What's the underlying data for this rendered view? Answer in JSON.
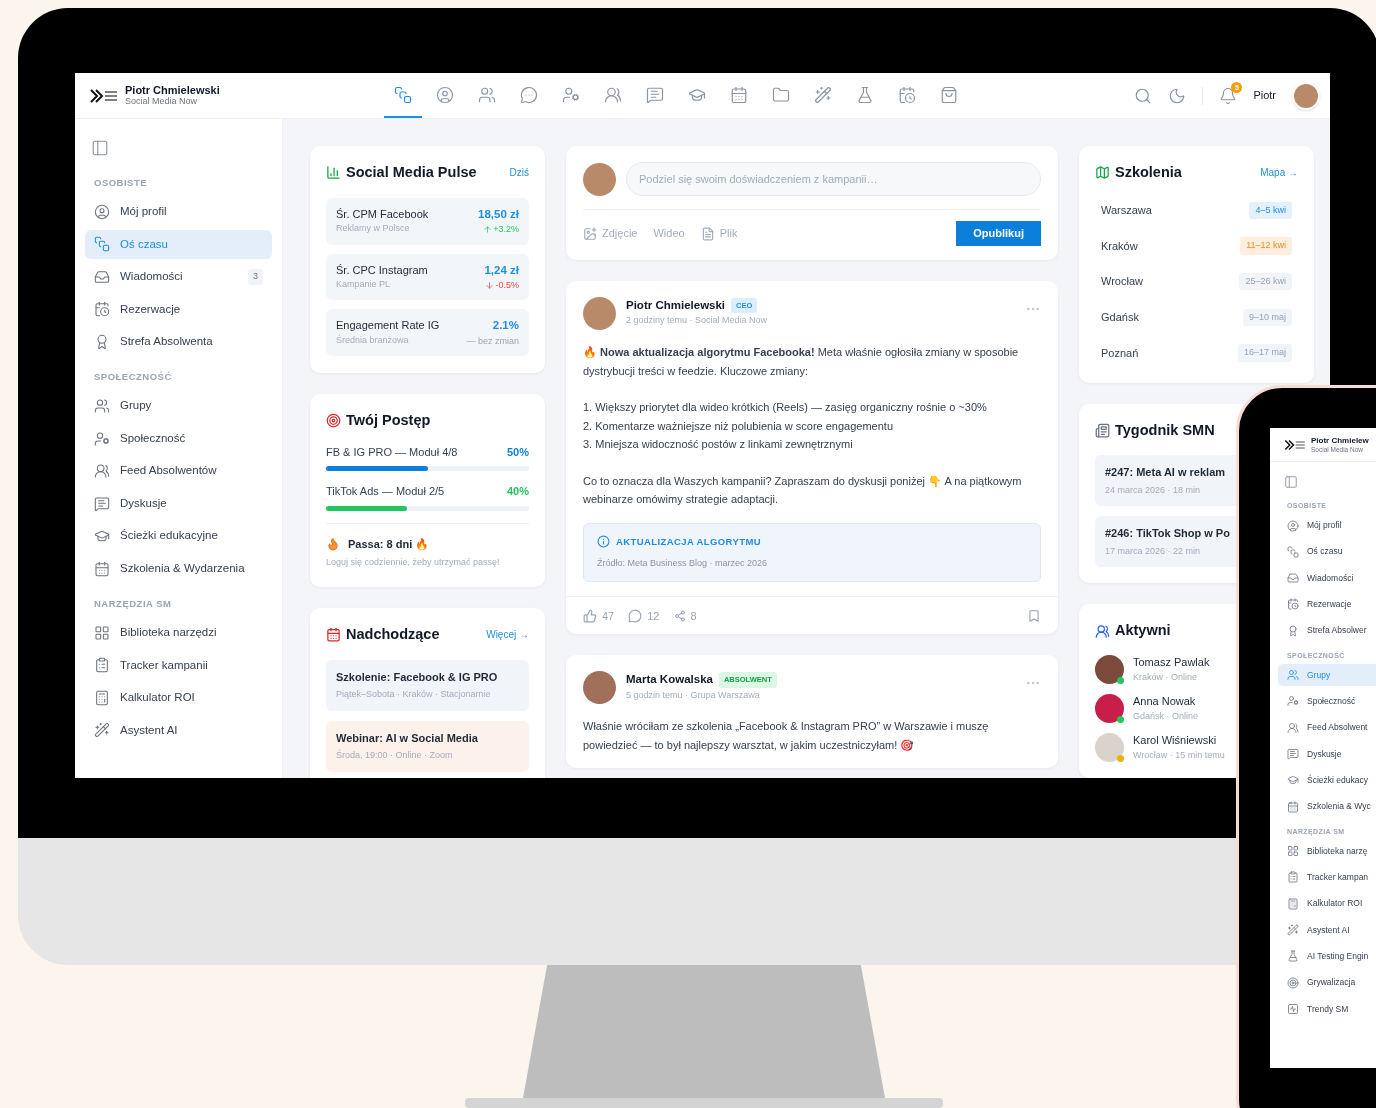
{
  "header": {
    "brand": {
      "name": "Piotr Chmielewski",
      "subtitle": "Social Media Now"
    },
    "nav": [
      {
        "selected": true
      },
      {
        "selected": false
      },
      {
        "selected": false
      },
      {
        "selected": false
      },
      {
        "selected": false
      },
      {
        "selected": false
      },
      {
        "selected": false
      },
      {
        "selected": false
      },
      {
        "selected": false
      },
      {
        "selected": false
      },
      {
        "selected": false
      },
      {
        "selected": false
      },
      {
        "selected": false
      },
      {
        "selected": false
      }
    ],
    "notifications": "5",
    "user": "Piotr"
  },
  "sidebar": {
    "sections": [
      {
        "title": "OSOBISTE",
        "items": [
          {
            "label": "Mój profil",
            "selected": false
          },
          {
            "label": "Oś czasu",
            "selected": true
          },
          {
            "label": "Wiadomości",
            "selected": false,
            "badge": "3"
          },
          {
            "label": "Rezerwacje",
            "selected": false
          },
          {
            "label": "Strefa Absolwenta",
            "selected": false
          }
        ]
      },
      {
        "title": "SPOŁECZNOŚĆ",
        "items": [
          {
            "label": "Grupy",
            "selected": false
          },
          {
            "label": "Społeczność",
            "selected": false
          },
          {
            "label": "Feed Absolwentów",
            "selected": false
          },
          {
            "label": "Dyskusje",
            "selected": false
          },
          {
            "label": "Ścieżki edukacyjne",
            "selected": false
          },
          {
            "label": "Szkolenia & Wydarzenia",
            "selected": false
          }
        ]
      },
      {
        "title": "NARZĘDZIA SM",
        "items": [
          {
            "label": "Biblioteka narzędzi",
            "selected": false
          },
          {
            "label": "Tracker kampanii",
            "selected": false
          },
          {
            "label": "Kalkulator ROI",
            "selected": false
          },
          {
            "label": "Asystent AI",
            "selected": false
          }
        ]
      }
    ]
  },
  "pulse": {
    "title": "Social Media Pulse",
    "link": "Dziś",
    "metrics": [
      {
        "label": "Śr. CPM Facebook",
        "sub": "Reklamy w Polsce",
        "value": "18,50 zł",
        "change": "+3.2%",
        "kind": "up"
      },
      {
        "label": "Śr. CPC Instagram",
        "sub": "Kampanie PL",
        "value": "1,24 zł",
        "change": "-0.5%",
        "kind": "down"
      },
      {
        "label": "Engagement Rate IG",
        "sub": "Średnia branżowa",
        "value": "2.1%",
        "change": "— bez zmian",
        "kind": "flat"
      }
    ]
  },
  "progress": {
    "title": "Twój Postęp",
    "courses": [
      {
        "label": "FB & IG PRO — Moduł 4/8",
        "percent": "50%",
        "level": 0.5,
        "color": "#0b7fd9"
      },
      {
        "label": "TikTok Ads — Moduł 2/5",
        "percent": "40%",
        "level": 0.4,
        "color": "#22c55e"
      }
    ],
    "streak": "Passa: 8 dni 🔥",
    "streak_hint": "Loguj się codziennie, żeby utrzymać passę!"
  },
  "upcoming": {
    "title": "Nadchodzące",
    "link": "Więcej →",
    "events": [
      {
        "title": "Szkolenie: Facebook & IG PRO",
        "details": "Piątek–Sobota · Kraków · Stacjonarnie",
        "kind": "training"
      },
      {
        "title": "Webinar: AI w Social Media",
        "details": "Środa, 19:00 · Online · Zoom",
        "kind": "webinar"
      }
    ]
  },
  "composer": {
    "placeholder": "Podziel się swoim doświadczeniem z kampanii…",
    "actions": [
      "Zdjęcie",
      "Wideo",
      "Plik"
    ],
    "submit": "Opublikuj"
  },
  "posts": [
    {
      "author": "Piotr Chmielewski",
      "badge": "CEO",
      "kind": "ceo",
      "meta": "2 godziny temu · Social Media Now",
      "body": [
        "🔥 **Nowa aktualizacja algorytmu Facebooka!** Meta właśnie ogłosiła zmiany w sposobie dystrybucji treści w feedzie. Kluczowe zmiany:",
        "1. Większy priorytet dla wideo krótkich (Reels) — zasięg organiczny rośnie o ~30%",
        "2. Komentarze ważniejsze niż polubienia w score engagementu",
        "3. Mniejsza widoczność postów z linkami zewnętrznymi",
        "Co to oznacza dla Waszych kampanii? Zapraszam do dyskusji poniżej 👇 A na piątkowym webinarze omówimy strategie adaptacji."
      ],
      "note": {
        "title": "AKTUALIZACJA ALGORYTMU",
        "source": "Źródło: Meta Business Blog · marzec 2026"
      },
      "likes": "47",
      "comments": "12",
      "shares": "8"
    },
    {
      "author": "Marta Kowalska",
      "badge": "ABSOLWENT",
      "kind": "alumni",
      "meta": "5 godzin temu · Grupa Warszawa",
      "body": [
        "Właśnie wróciłam ze szkolenia „Facebook & Instagram PRO” w Warszawie i muszę powiedzieć — to był najlepszy warsztat, w jakim uczestniczyłam! 🎯"
      ]
    }
  ],
  "trainings": {
    "title": "Szkolenia",
    "link": "Mapa →",
    "cities": [
      {
        "city": "Warszawa",
        "dates": "4–5 kwi",
        "kind": "next"
      },
      {
        "city": "Kraków",
        "dates": "11–12 kwi",
        "kind": "soon"
      },
      {
        "city": "Wrocław",
        "dates": "25–26 kwi",
        "kind": "later"
      },
      {
        "city": "Gdańsk",
        "dates": "9–10 maj",
        "kind": "later"
      },
      {
        "city": "Poznań",
        "dates": "16–17 maj",
        "kind": "later"
      }
    ]
  },
  "newsletter": {
    "title": "Tygodnik SMN",
    "issues": [
      {
        "title": "#247: Meta AI w reklam",
        "meta": "24 marca 2026 · 18 min"
      },
      {
        "title": "#246: TikTok Shop w Po",
        "meta": "17 marca 2026 · 22 min"
      }
    ]
  },
  "active": {
    "title": "Aktywni",
    "users": [
      {
        "name": "Tomasz Pawlak",
        "meta": "Kraków · Online",
        "color": "#22c55e"
      },
      {
        "name": "Anna Nowak",
        "meta": "Gdańsk · Online",
        "color": "#22c55e"
      },
      {
        "name": "Karol Wiśniewski",
        "meta": "Wrocław · 15 min temu",
        "color": "#eab308"
      }
    ]
  },
  "phone": {
    "brand": {
      "name": "Piotr Chmielew",
      "subtitle": "Social Media Now"
    },
    "sections": [
      {
        "title": "OSOBISTE",
        "items": [
          {
            "label": "Mój profil",
            "selected": false
          },
          {
            "label": "Oś czasu",
            "selected": false
          },
          {
            "label": "Wiadomości",
            "selected": false
          },
          {
            "label": "Rezerwacje",
            "selected": false
          },
          {
            "label": "Strefa Absolwer",
            "selected": false
          }
        ]
      },
      {
        "title": "SPOŁECZNOŚĆ",
        "items": [
          {
            "label": "Grupy",
            "selected": true
          },
          {
            "label": "Społeczność",
            "selected": false
          },
          {
            "label": "Feed Absolwent",
            "selected": false
          },
          {
            "label": "Dyskusje",
            "selected": false
          },
          {
            "label": "Ścieżki edukacy",
            "selected": false
          },
          {
            "label": "Szkolenia & Wyc",
            "selected": false
          }
        ]
      },
      {
        "title": "NARZĘDZIA SM",
        "items": [
          {
            "label": "Biblioteka narzę",
            "selected": false
          },
          {
            "label": "Tracker kampan",
            "selected": false
          },
          {
            "label": "Kalkulator ROI",
            "selected": false
          },
          {
            "label": "Asystent AI",
            "selected": false
          },
          {
            "label": "AI Testing Engin",
            "selected": false
          },
          {
            "label": "Grywalizacja",
            "selected": false
          },
          {
            "label": "Trendy SM",
            "selected": false
          }
        ]
      }
    ]
  }
}
